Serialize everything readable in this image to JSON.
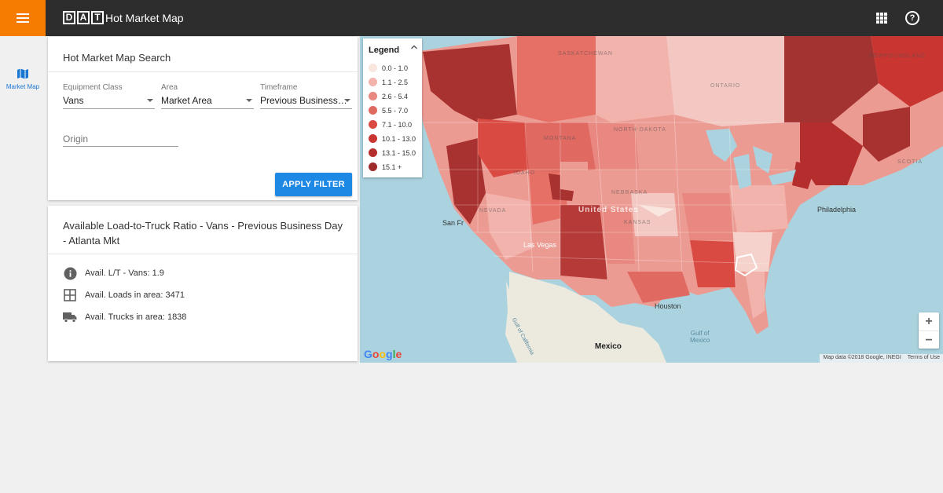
{
  "header": {
    "logo_letters": [
      "D",
      "A",
      "T"
    ],
    "title": "Hot Market Map"
  },
  "rail": {
    "items": [
      {
        "label": "Market Map",
        "icon": "map-icon"
      }
    ]
  },
  "search": {
    "title": "Hot Market Map Search",
    "equipment": {
      "label": "Equipment Class",
      "value": "Vans"
    },
    "area": {
      "label": "Area",
      "value": "Market Area"
    },
    "timeframe": {
      "label": "Timeframe",
      "value": "Previous Business…"
    },
    "origin": {
      "placeholder": "Origin",
      "value": ""
    },
    "apply_label": "APPLY FILTER"
  },
  "info": {
    "title": "Available Load-to-Truck Ratio - Vans - Previous Business Day - Atlanta Mkt",
    "stats": [
      {
        "icon": "info-icon",
        "text": "Avail. L/T - Vans: 1.9"
      },
      {
        "icon": "grid-icon",
        "text": "Avail. Loads in area: 3471"
      },
      {
        "icon": "truck-icon",
        "text": "Avail. Trucks in area: 1838"
      }
    ]
  },
  "legend": {
    "title": "Legend",
    "items": [
      {
        "label": "0.0 - 1.0",
        "color": "#f9e6df"
      },
      {
        "label": "1.1 - 2.5",
        "color": "#f2b3ac"
      },
      {
        "label": "2.6 - 5.4",
        "color": "#e88880"
      },
      {
        "label": "5.5 - 7.0",
        "color": "#e06a62"
      },
      {
        "label": "7.1 - 10.0",
        "color": "#d94a42"
      },
      {
        "label": "10.1 - 13.0",
        "color": "#c93632"
      },
      {
        "label": "13.1 - 15.0",
        "color": "#b52e2e"
      },
      {
        "label": "15.1 +",
        "color": "#9e2a2a"
      }
    ]
  },
  "map": {
    "labels": {
      "united_states": "United States",
      "mexico": "Mexico",
      "gulf_mexico": "Gulf of\nMexico",
      "gulf_california": "Gulf of California",
      "philadelphia": "Philadelphia",
      "las_vegas": "Las Vegas",
      "houston": "Houston",
      "san_fr": "San Fr",
      "ontario": "ONTARIO",
      "newfoundland": "NEWFOUNDLAND",
      "north_dakota": "NORTH DAKOTA",
      "nebraska": "NEBRASKA",
      "kansas": "KANSAS",
      "montana": "MONTANA",
      "idaho": "IDAHO",
      "nevada": "NEVADA",
      "saskatchewan": "SASKATCHEWAN",
      "scotia": "SCOTIA"
    },
    "attribution": "Map data ©2018 Google, INEGI",
    "terms": "Terms of Use",
    "zoom_in": "+",
    "zoom_out": "−",
    "google": "Google"
  }
}
